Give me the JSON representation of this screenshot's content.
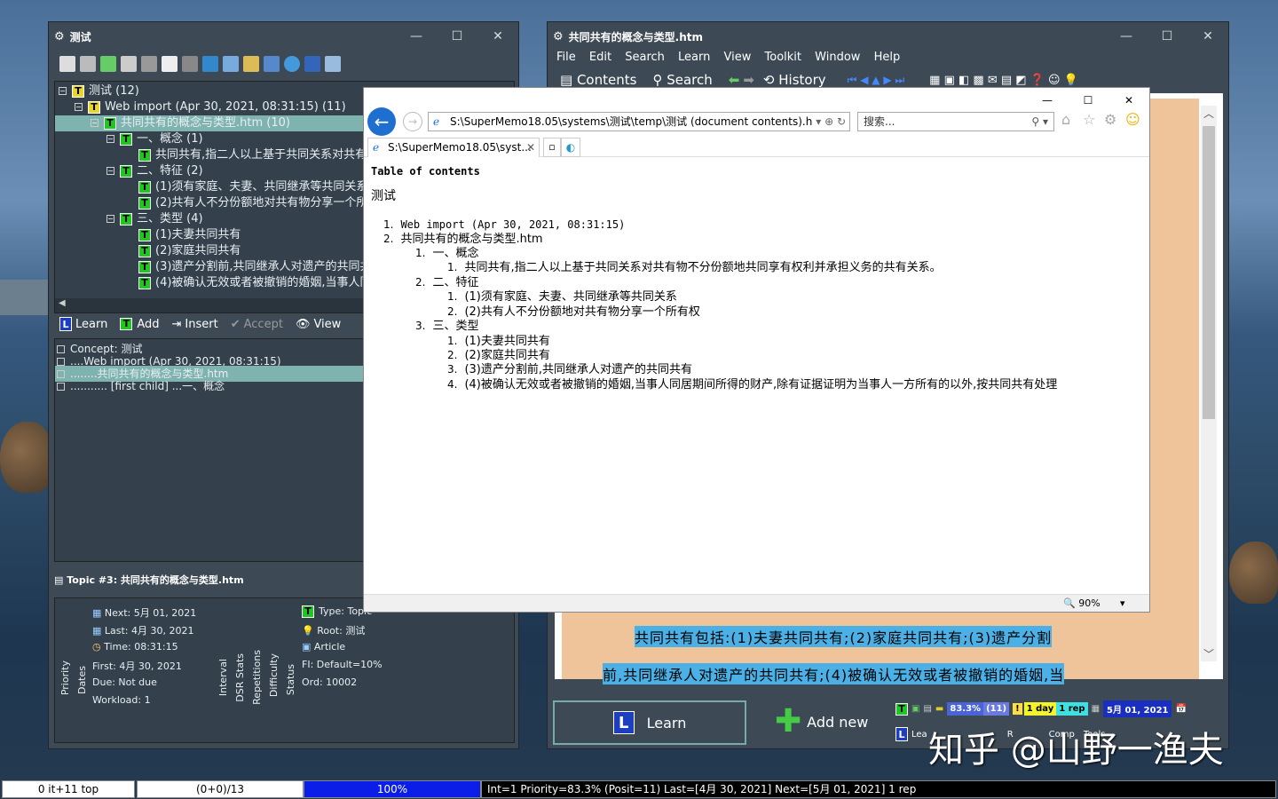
{
  "left_window": {
    "title": "测试",
    "tree": [
      {
        "label": "测试 (12)"
      },
      {
        "label": "Web import (Apr 30, 2021, 08:31:15) (11)"
      },
      {
        "label": "共同共有的概念与类型.htm (10)"
      },
      {
        "label": "一、概念 (1)"
      },
      {
        "label": "共同共有,指二人以上基于共同关系对共有物"
      },
      {
        "label": "二、特征 (2)"
      },
      {
        "label": "(1)须有家庭、夫妻、共同继承等共同关系"
      },
      {
        "label": "(2)共有人不分份额地对共有物分享一个所有"
      },
      {
        "label": "三、类型 (4)"
      },
      {
        "label": "(1)夫妻共同共有"
      },
      {
        "label": "(2)家庭共同共有"
      },
      {
        "label": "(3)遗产分割前,共同继承人对遗产的共同共有"
      },
      {
        "label": "(4)被确认无效或者被撤销的婚姻,当事人同居"
      }
    ],
    "actions": {
      "learn": "Learn",
      "add": "Add",
      "insert": "Insert",
      "accept": "Accept",
      "view": "View"
    },
    "concept_list": [
      "Concept: 测试",
      "....Web import (Apr 30, 2021, 08:31:15)",
      "........共同共有的概念与类型.htm",
      "........... [first child] ...一、概念"
    ]
  },
  "topic_panel": {
    "title": "Topic #3: 共同共有的概念与类型.htm",
    "next": "Next: 5月 01, 2021",
    "last": "Last: 4月 30, 2021",
    "time": "Time: 08:31:15",
    "first": "First: 4月 30, 2021",
    "due": "Due: Not due",
    "workload": "Workload: 1",
    "type": "Type: Topic",
    "root": "Root: 测试",
    "article": "Article",
    "fi": "FI: Default=10%",
    "ord": "Ord: 10002",
    "vlabels": [
      "Priority",
      "Dates",
      "Interval",
      "DSR Stats",
      "Repetitions",
      "Difficulty",
      "Status"
    ]
  },
  "right_window": {
    "title": "共同共有的概念与类型.htm",
    "menu": [
      "File",
      "Edit",
      "Search",
      "Learn",
      "View",
      "Toolkit",
      "Window",
      "Help"
    ],
    "toolbar": {
      "contents": "Contents",
      "search": "Search",
      "history": "History"
    },
    "text_line1": "共同共有包括:(1)夫妻共同共有;(2)家庭共同共有;(3)遗产分割",
    "text_line2": "前,共同继承人对遗产的共同共有;(4)被确认无效或者被撤销的婚姻,当",
    "learn_button": "Learn",
    "add_new_button": "Add new",
    "stats": {
      "pct": "83.3%",
      "count": "(11)",
      "day": "1 day",
      "rep": "1 rep",
      "date": "5月 01, 2021"
    },
    "bottom_mini": {
      "learn": "Lea",
      "tools": "Tools",
      "r": "R",
      "comp": "Comp"
    }
  },
  "ie_window": {
    "address": "S:\\SuperMemo18.05\\systems\\测试\\temp\\测试 (document contents).h",
    "search_placeholder": "搜索...",
    "tab_label": "S:\\SuperMemo18.05\\syst...",
    "zoom": "90%",
    "toc_title": "Table of contents",
    "root": "测试",
    "items": [
      {
        "num": "1.",
        "text": "Web import (Apr 30, 2021, 08:31:15)"
      },
      {
        "num": "2.",
        "text": "共同共有的概念与类型.htm"
      },
      {
        "num": "1.",
        "text": "一、概念"
      },
      {
        "num": "1.",
        "text": "共同共有,指二人以上基于共同关系对共有物不分份额地共同享有权利并承担义务的共有关系。"
      },
      {
        "num": "2.",
        "text": "二、特征"
      },
      {
        "num": "1.",
        "text": "(1)须有家庭、夫妻、共同继承等共同关系"
      },
      {
        "num": "2.",
        "text": "(2)共有人不分份额地对共有物分享一个所有权"
      },
      {
        "num": "3.",
        "text": "三、类型"
      },
      {
        "num": "1.",
        "text": "(1)夫妻共同共有"
      },
      {
        "num": "2.",
        "text": "(2)家庭共同共有"
      },
      {
        "num": "3.",
        "text": "(3)遗产分割前,共同继承人对遗产的共同共有"
      },
      {
        "num": "4.",
        "text": "(4)被确认无效或者被撤销的婚姻,当事人同居期间所得的财产,除有证据证明为当事人一方所有的以外,按共同共有处理"
      }
    ]
  },
  "statusbar": {
    "s1": "0 it+11 top",
    "s2": "(0+0)/13",
    "s3": "100%",
    "s4": "Int=1 Priority=83.3% (Posit=11) Last=[4月 30, 2021] Next=[5月 01, 2021] 1 rep"
  },
  "watermark": "知乎 @山野一渔夫"
}
